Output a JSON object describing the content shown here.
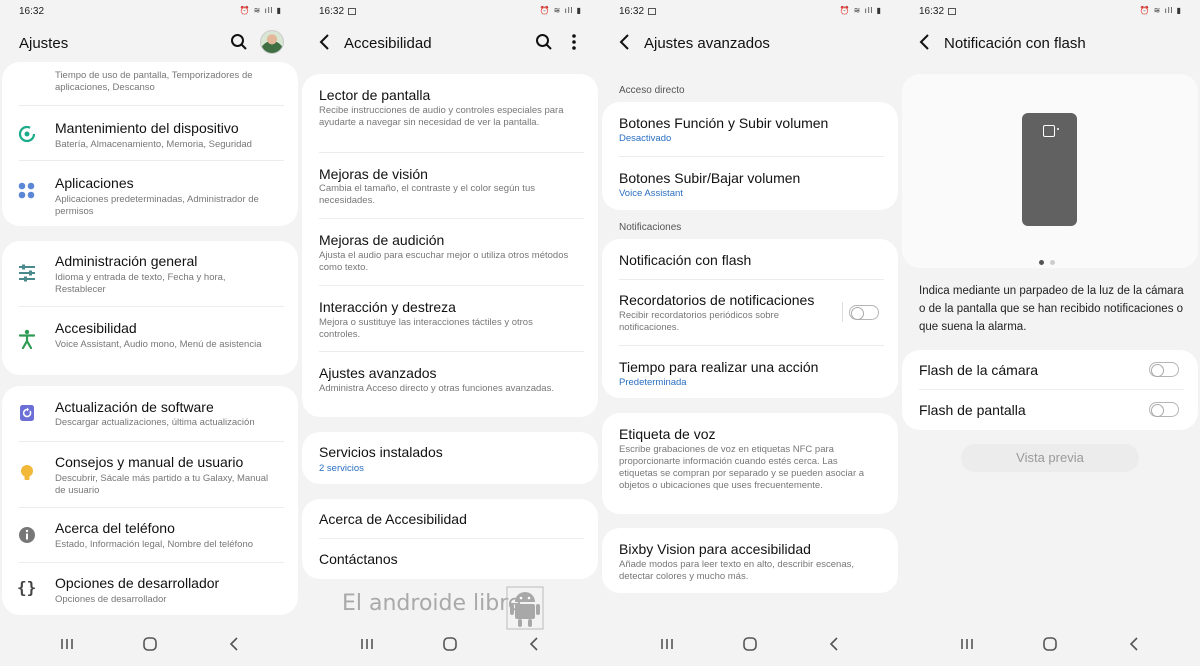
{
  "status_time": "16:32",
  "s1": {
    "title": "Ajustes",
    "top_partial": "Tiempo de uso de pantalla, Temporizadores de aplicaciones, Descanso",
    "items": [
      {
        "title": "Mantenimiento del dispositivo",
        "subtitle": "Batería, Almacenamiento, Memoria, Seguridad",
        "icon": "device-care-icon"
      },
      {
        "title": "Aplicaciones",
        "subtitle": "Aplicaciones predeterminadas, Administrador de permisos",
        "icon": "apps-icon"
      },
      {
        "title": "Administración general",
        "subtitle": "Idioma y entrada de texto, Fecha y hora, Restablecer",
        "icon": "sliders-icon"
      },
      {
        "title": "Accesibilidad",
        "subtitle": "Voice Assistant, Audio mono, Menú de asistencia",
        "icon": "accessibility-icon"
      },
      {
        "title": "Actualización de software",
        "subtitle": "Descargar actualizaciones, última actualización",
        "icon": "software-update-icon"
      },
      {
        "title": "Consejos y manual de usuario",
        "subtitle": "Descubrir, Sácale más partido a tu Galaxy, Manual de usuario",
        "icon": "lightbulb-icon"
      },
      {
        "title": "Acerca del teléfono",
        "subtitle": "Estado, Información legal, Nombre del teléfono",
        "icon": "info-icon"
      },
      {
        "title": "Opciones de desarrollador",
        "subtitle": "Opciones de desarrollador",
        "icon": "braces-icon"
      }
    ]
  },
  "s2": {
    "title": "Accesibilidad",
    "items": [
      {
        "title": "Lector de pantalla",
        "subtitle": "Recibe instrucciones de audio y controles especiales para ayudarte a navegar sin necesidad de ver la pantalla."
      },
      {
        "title": "Mejoras de visión",
        "subtitle": "Cambia el tamaño, el contraste y el color según tus necesidades."
      },
      {
        "title": "Mejoras de audición",
        "subtitle": "Ajusta el audio para escuchar mejor o utiliza otros métodos como texto."
      },
      {
        "title": "Interacción y destreza",
        "subtitle": "Mejora o sustituye las interacciones táctiles y otros controles."
      },
      {
        "title": "Ajustes avanzados",
        "subtitle": "Administra Acceso directo y otras funciones avanzadas."
      },
      {
        "title": "Servicios instalados",
        "subtitle": "2 servicios"
      },
      {
        "title": "Acerca de Accesibilidad"
      },
      {
        "title": "Contáctanos"
      }
    ],
    "watermark": "El androide libre"
  },
  "s3": {
    "title": "Ajustes avanzados",
    "section_shortcut": "Acceso directo",
    "section_notifications": "Notificaciones",
    "items": [
      {
        "title": "Botones Función y Subir volumen",
        "subtitle": "Desactivado"
      },
      {
        "title": "Botones Subir/Bajar volumen",
        "subtitle": "Voice Assistant"
      },
      {
        "title": "Notificación con flash"
      },
      {
        "title": "Recordatorios de notificaciones",
        "subtitle": "Recibir recordatorios periódicos sobre notificaciones.",
        "toggle": false
      },
      {
        "title": "Tiempo para realizar una acción",
        "subtitle": "Predeterminada"
      },
      {
        "title": "Etiqueta de voz",
        "subtitle": "Escribe grabaciones de voz en etiquetas NFC para proporcionarte información cuando estés cerca. Las etiquetas se compran por separado y se pueden asociar a objetos o ubicaciones que uses frecuentemente."
      },
      {
        "title": "Bixby Vision para accesibilidad",
        "subtitle": "Añade modos para leer texto en alto, describir escenas, detectar colores y mucho más."
      }
    ]
  },
  "s4": {
    "title": "Notificación con flash",
    "description": "Indica mediante un parpadeo de la luz de la cámara o de la pantalla que se han recibido notificaciones o que suena la alarma.",
    "items": [
      {
        "title": "Flash de la cámara",
        "toggle": false
      },
      {
        "title": "Flash de pantalla",
        "toggle": false
      }
    ],
    "preview_button": "Vista previa",
    "carousel_page": 1,
    "carousel_pages": 2
  }
}
